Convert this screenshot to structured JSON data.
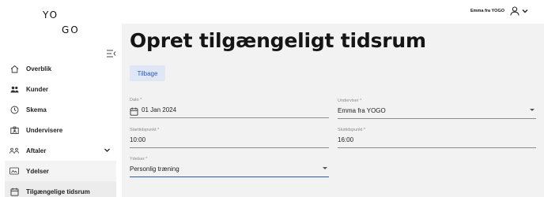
{
  "logo": {
    "line1": "YO",
    "line2": "GO"
  },
  "header": {
    "user_name": "Emma fra YOGO"
  },
  "sidebar": {
    "items": [
      {
        "label": "Overblik",
        "icon": "home-icon"
      },
      {
        "label": "Kunder",
        "icon": "users-icon"
      },
      {
        "label": "Skema",
        "icon": "clock-icon"
      },
      {
        "label": "Undervisere",
        "icon": "badge-icon"
      },
      {
        "label": "Aftaler",
        "icon": "group-icon"
      },
      {
        "label": "Ydelser",
        "icon": "card-icon"
      },
      {
        "label": "Tilgængelige tidsrum",
        "icon": "calendar-icon"
      }
    ]
  },
  "page": {
    "title": "Opret tilgængeligt tidsrum",
    "back_label": "Tilbage"
  },
  "form": {
    "date": {
      "label": "Dato *",
      "value": "01 Jan 2024"
    },
    "teacher": {
      "label": "Underviser *",
      "value": "Emma fra YOGO"
    },
    "start": {
      "label": "Starttidspunkt *",
      "value": "10:00"
    },
    "end": {
      "label": "Sluttidspunkt *",
      "value": "16:00"
    },
    "service": {
      "label": "Ydelser *",
      "value": "Personlig træning"
    }
  }
}
